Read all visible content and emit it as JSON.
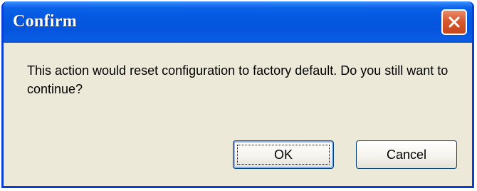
{
  "dialog": {
    "title": "Confirm",
    "message": "This action would reset configuration to factory default.  Do you still want to continue?",
    "buttons": {
      "ok_label": "OK",
      "cancel_label": "Cancel"
    },
    "close_icon": "close-icon",
    "colors": {
      "titlebar": "#0558e0",
      "close_button": "#d6592f",
      "body": "#ece9d8"
    }
  }
}
